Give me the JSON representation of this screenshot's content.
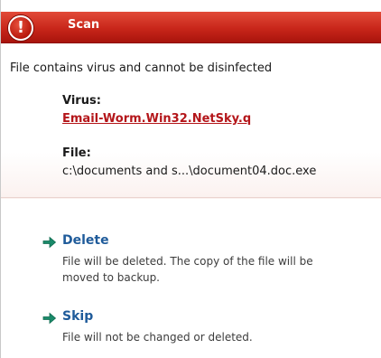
{
  "window": {
    "title": "Scan",
    "alert_icon_glyph": "!",
    "title_bar_color": "#c8261a"
  },
  "message": "File contains virus and cannot be disinfected",
  "virus": {
    "label": "Virus:",
    "name": "Email-Worm.Win32.NetSky.q"
  },
  "file": {
    "label": "File:",
    "path": "c:\\documents and s...\\document04.doc.exe"
  },
  "actions": [
    {
      "title": "Delete",
      "description": "File will be deleted. The copy of the file will be moved to backup.",
      "icon": "green-arrow-icon"
    },
    {
      "title": "Skip",
      "description": "File will not be changed or deleted.",
      "icon": "green-arrow-icon"
    }
  ],
  "colors": {
    "link_red": "#b4161a",
    "action_blue": "#1f5b9a",
    "arrow_green": "#1a8a6a"
  }
}
